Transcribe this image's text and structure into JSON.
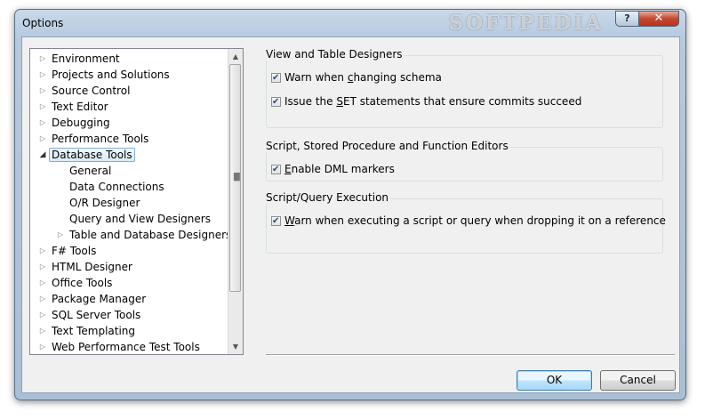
{
  "window": {
    "title": "Options",
    "watermark": "SOFTPEDIA",
    "help_label": "?",
    "close_label": "✕"
  },
  "tree": {
    "items": [
      {
        "label": "Environment",
        "indent": 0,
        "arrow": "▷"
      },
      {
        "label": "Projects and Solutions",
        "indent": 0,
        "arrow": "▷"
      },
      {
        "label": "Source Control",
        "indent": 0,
        "arrow": "▷"
      },
      {
        "label": "Text Editor",
        "indent": 0,
        "arrow": "▷"
      },
      {
        "label": "Debugging",
        "indent": 0,
        "arrow": "▷"
      },
      {
        "label": "Performance Tools",
        "indent": 0,
        "arrow": "▷"
      },
      {
        "label": "Database Tools",
        "indent": 0,
        "arrow": "◢",
        "selected": true
      },
      {
        "label": "General",
        "indent": 1,
        "arrow": ""
      },
      {
        "label": "Data Connections",
        "indent": 1,
        "arrow": ""
      },
      {
        "label": "O/R Designer",
        "indent": 1,
        "arrow": ""
      },
      {
        "label": "Query and View Designers",
        "indent": 1,
        "arrow": ""
      },
      {
        "label": "Table and Database Designers",
        "indent": 1,
        "arrow": "▷"
      },
      {
        "label": "F# Tools",
        "indent": 0,
        "arrow": "▷"
      },
      {
        "label": "HTML Designer",
        "indent": 0,
        "arrow": "▷"
      },
      {
        "label": "Office Tools",
        "indent": 0,
        "arrow": "▷"
      },
      {
        "label": "Package Manager",
        "indent": 0,
        "arrow": "▷"
      },
      {
        "label": "SQL Server Tools",
        "indent": 0,
        "arrow": "▷"
      },
      {
        "label": "Text Templating",
        "indent": 0,
        "arrow": "▷"
      },
      {
        "label": "Web Performance Test Tools",
        "indent": 0,
        "arrow": "▷"
      }
    ]
  },
  "groups": {
    "view_table": {
      "title": "View and Table Designers",
      "warn_schema": {
        "pre": "Warn when ",
        "key": "c",
        "post": "hanging schema",
        "checked": true
      },
      "issue_set": {
        "pre": "Issue the ",
        "key": "S",
        "post": "ET statements that ensure commits succeed",
        "checked": true
      }
    },
    "script_editors": {
      "title": "Script, Stored Procedure and Function Editors",
      "enable_dml": {
        "pre": "",
        "key": "E",
        "post": "nable DML markers",
        "checked": true
      }
    },
    "script_exec": {
      "title": "Script/Query Execution",
      "warn_drop": {
        "pre": "",
        "key": "W",
        "post": "arn when executing a script or query when dropping it on a reference",
        "checked": true
      }
    }
  },
  "buttons": {
    "ok": "OK",
    "cancel": "Cancel"
  }
}
